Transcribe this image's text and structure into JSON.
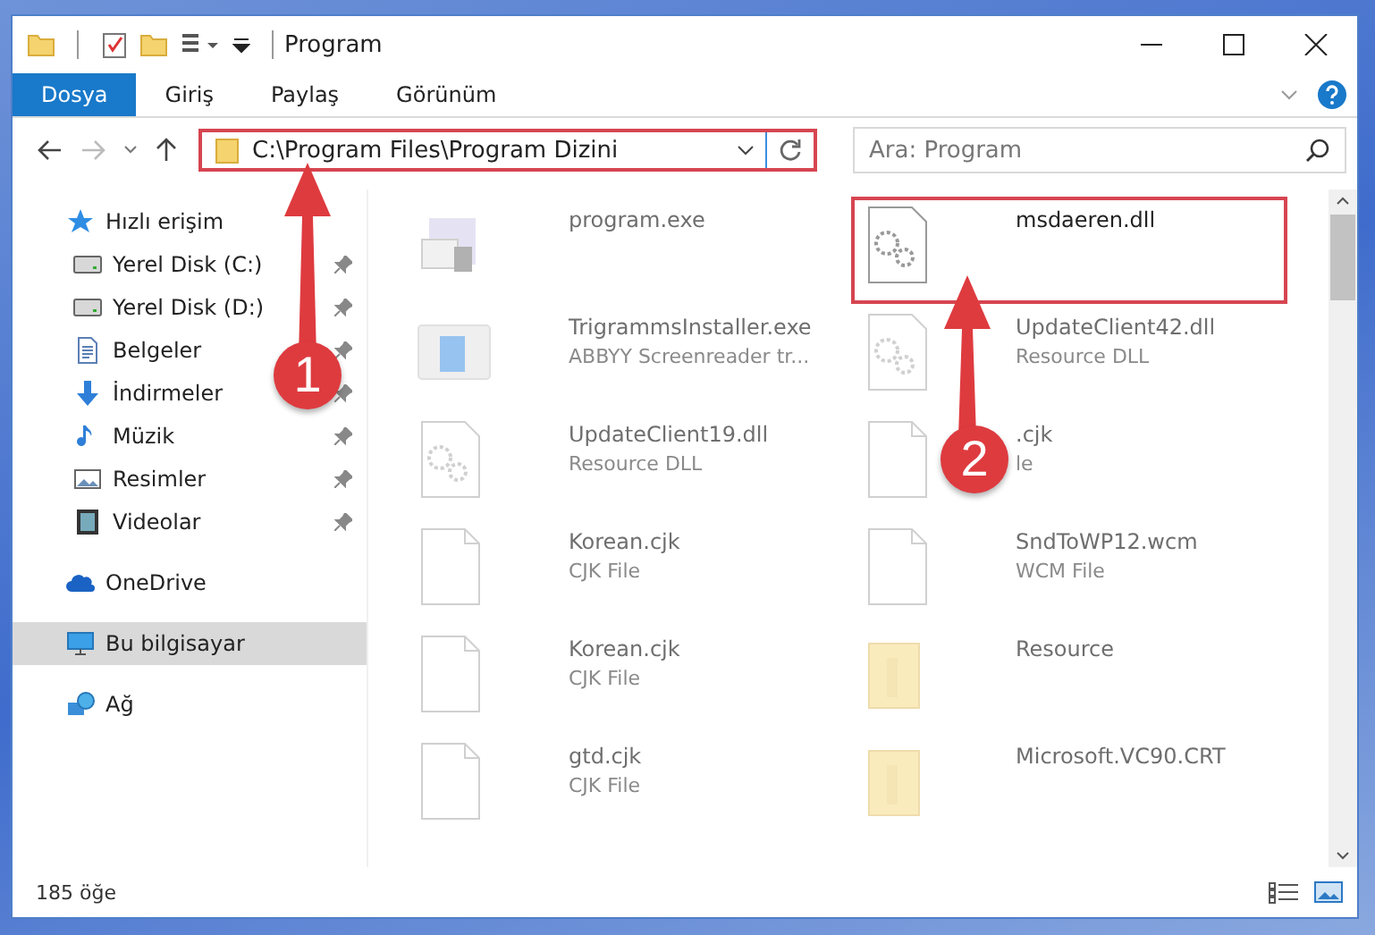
{
  "window": {
    "title": "Program"
  },
  "ribbon_tabs": [
    {
      "label": "Dosya",
      "selected": true
    },
    {
      "label": "Giriş",
      "selected": false
    },
    {
      "label": "Paylaş",
      "selected": false
    },
    {
      "label": "Görünüm",
      "selected": false
    }
  ],
  "address": {
    "path": "C:\\Program Files\\Program Dizini",
    "highlighted": true
  },
  "search": {
    "placeholder": "Ara: Program"
  },
  "sidebar": {
    "items": [
      {
        "label": "Hızlı erişim",
        "kind": "star",
        "selected": false,
        "children": [
          {
            "label": "Yerel Disk (C:)",
            "kind": "drive",
            "pinned": true,
            "selected": false
          },
          {
            "label": "Yerel Disk (D:)",
            "kind": "drive",
            "pinned": true,
            "selected": false
          },
          {
            "label": "Belgeler",
            "kind": "document",
            "pinned": true,
            "selected": false
          },
          {
            "label": "İndirmeler",
            "kind": "download",
            "pinned": true,
            "selected": false
          },
          {
            "label": "Müzik",
            "kind": "music",
            "pinned": true,
            "selected": false
          },
          {
            "label": "Resimler",
            "kind": "picture",
            "pinned": true,
            "selected": false
          },
          {
            "label": "Videolar",
            "kind": "video",
            "pinned": true,
            "selected": false
          }
        ]
      },
      {
        "label": "OneDrive",
        "kind": "cloud",
        "selected": false
      },
      {
        "label": "Bu bilgisayar",
        "kind": "computer",
        "selected": true
      },
      {
        "label": "Ağ",
        "kind": "network",
        "selected": false
      }
    ]
  },
  "files": [
    {
      "name": "program.exe",
      "kind": "app",
      "highlighted": false
    },
    {
      "name": "msdaeren.dll",
      "kind": "settings",
      "highlighted": true
    },
    {
      "name": "TrigrammsInstaller.exe",
      "type": "ABBYY Screenreader tr...",
      "kind": "installer",
      "highlighted": false
    },
    {
      "name": "UpdateClient42.dll",
      "type": "Resource DLL",
      "kind": "settings",
      "highlighted": false
    },
    {
      "name": "UpdateClient19.dll",
      "type": "Resource DLL",
      "kind": "settings",
      "highlighted": false
    },
    {
      "name": ".cjk",
      "type": "le",
      "kind": "file",
      "highlighted": false
    },
    {
      "name": "Korean.cjk",
      "type": "CJK File",
      "kind": "file",
      "highlighted": false
    },
    {
      "name": "SndToWP12.wcm",
      "type": "WCM File",
      "kind": "file",
      "highlighted": false
    },
    {
      "name": "Korean.cjk",
      "type": "CJK File",
      "kind": "file",
      "highlighted": false
    },
    {
      "name": "Resource",
      "kind": "folder",
      "highlighted": false
    },
    {
      "name": "gtd.cjk",
      "type": "CJK File",
      "kind": "file",
      "highlighted": false
    },
    {
      "name": "Microsoft.VC90.CRT",
      "kind": "folder",
      "highlighted": false
    }
  ],
  "annotations": [
    {
      "label": "1"
    },
    {
      "label": "2"
    }
  ],
  "status_bar": {
    "count": "185 öğe"
  }
}
